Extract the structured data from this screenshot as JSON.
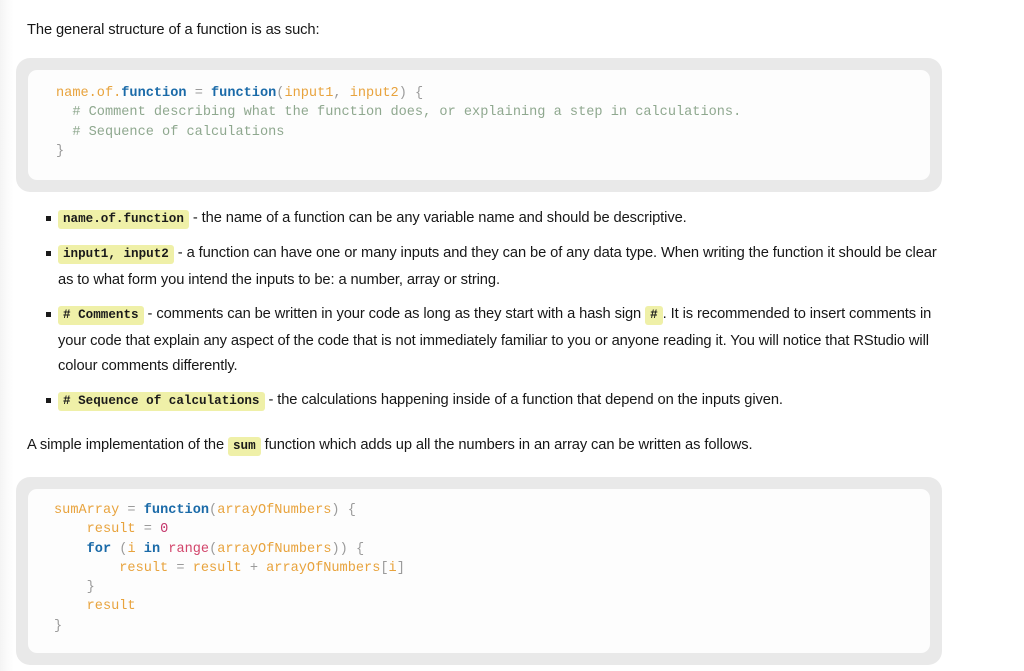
{
  "intro": {
    "text": "The general structure of a function is as such:"
  },
  "code_blocks": [
    {
      "name": "general-function-structure",
      "lines": [
        [
          {
            "t": "name.of.",
            "c": "var"
          },
          {
            "t": "function",
            "c": "kw"
          },
          {
            "t": " = ",
            "c": "punct"
          },
          {
            "t": "function",
            "c": "kw"
          },
          {
            "t": "(",
            "c": "punct"
          },
          {
            "t": "input1",
            "c": "var"
          },
          {
            "t": ", ",
            "c": "punct"
          },
          {
            "t": "input2",
            "c": "var"
          },
          {
            "t": ") {",
            "c": "punct"
          }
        ],
        [
          {
            "t": "  # Comment describing what the function does, or explaining a step in calculations.",
            "c": "comment"
          }
        ],
        [
          {
            "t": "  # Sequence of calculations",
            "c": "comment"
          }
        ],
        [
          {
            "t": "}",
            "c": "punct"
          }
        ]
      ]
    },
    {
      "name": "sum-array-implementation",
      "lines": [
        [
          {
            "t": "sumArray",
            "c": "var"
          },
          {
            "t": " = ",
            "c": "punct"
          },
          {
            "t": "function",
            "c": "kw"
          },
          {
            "t": "(",
            "c": "punct"
          },
          {
            "t": "arrayOfNumbers",
            "c": "var"
          },
          {
            "t": ") {",
            "c": "punct"
          }
        ],
        [
          {
            "t": "    ",
            "c": "punct"
          },
          {
            "t": "result",
            "c": "var"
          },
          {
            "t": " = ",
            "c": "punct"
          },
          {
            "t": "0",
            "c": "num"
          }
        ],
        [
          {
            "t": "    ",
            "c": "punct"
          },
          {
            "t": "for",
            "c": "kw"
          },
          {
            "t": " (",
            "c": "punct"
          },
          {
            "t": "i",
            "c": "var"
          },
          {
            "t": " ",
            "c": "punct"
          },
          {
            "t": "in",
            "c": "kw"
          },
          {
            "t": " ",
            "c": "punct"
          },
          {
            "t": "range",
            "c": "fn"
          },
          {
            "t": "(",
            "c": "punct"
          },
          {
            "t": "arrayOfNumbers",
            "c": "var"
          },
          {
            "t": ")) {",
            "c": "punct"
          }
        ],
        [
          {
            "t": "        ",
            "c": "punct"
          },
          {
            "t": "result",
            "c": "var"
          },
          {
            "t": " = ",
            "c": "punct"
          },
          {
            "t": "result",
            "c": "var"
          },
          {
            "t": " + ",
            "c": "punct"
          },
          {
            "t": "arrayOfNumbers",
            "c": "var"
          },
          {
            "t": "[",
            "c": "punct"
          },
          {
            "t": "i",
            "c": "var"
          },
          {
            "t": "]",
            "c": "punct"
          }
        ],
        [
          {
            "t": "    }",
            "c": "punct"
          }
        ],
        [
          {
            "t": "    ",
            "c": "punct"
          },
          {
            "t": "result",
            "c": "var"
          }
        ],
        [
          {
            "t": "}",
            "c": "punct"
          }
        ]
      ]
    }
  ],
  "bullets": [
    {
      "code": "name.of.function",
      "text_after": " - the name of a function can be any variable name and should be descriptive."
    },
    {
      "code": "input1, input2",
      "text_after": " - a function can have one or many inputs and they can be of any data type. When writing the function it should be clear as to what form you intend the inputs to be: a number, array or string."
    },
    {
      "code": "# Comments",
      "text_before_inline": " - comments can be written in your code as long as they start with a hash sign ",
      "inline_code": "#",
      "text_after": ". It is recommended to insert comments in your code that explain any aspect of the code that is not immediately familiar to you or anyone reading it. You will notice that RStudio will colour comments differently."
    },
    {
      "code": "# Sequence of calculations",
      "text_after": " - the calculations happening inside of a function that depend on the inputs given."
    }
  ],
  "mid_paragraph": {
    "text_before": "A simple implementation of the ",
    "code": "sum",
    "text_after": " function which adds up all the numbers in an array can be written as follows."
  },
  "colors": {
    "page_background": "#ffffff",
    "code_outer_background": "#e9e9e9",
    "code_inner_background": "#fdfdfd",
    "highlight_background": "#eff0a8",
    "token_variable": "#e8a33d",
    "token_keyword": "#1a6aa8",
    "token_comment": "#8fa88f",
    "token_punctuation": "#9b9b9b",
    "token_number": "#c4356a",
    "token_function": "#d2456b",
    "body_text": "#171717"
  }
}
